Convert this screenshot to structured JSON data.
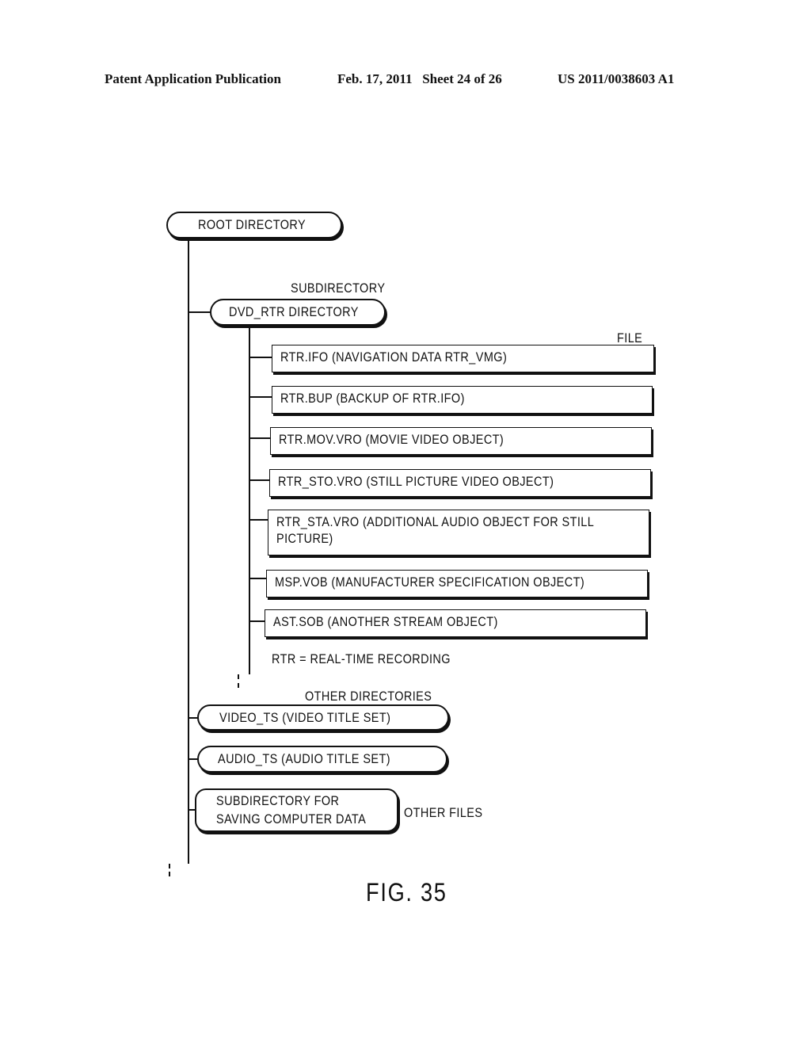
{
  "header": {
    "publication": "Patent Application Publication",
    "date_sheet": "Feb. 17, 2011   Sheet 24 of 26",
    "number": "US 2011/0038603 A1"
  },
  "diagram": {
    "root": "ROOT DIRECTORY",
    "subdirectory_label": "SUBDIRECTORY",
    "dvd_rtr": "DVD_RTR DIRECTORY",
    "file_label": "FILE",
    "files": [
      {
        "line1": "RTR.IFO (NAVIGATION DATA RTR_VMG)"
      },
      {
        "line1": "RTR.BUP (BACKUP OF RTR.IFO)"
      },
      {
        "line1": "RTR.MOV.VRO (MOVIE VIDEO OBJECT)"
      },
      {
        "line1": "RTR_STO.VRO (STILL PICTURE VIDEO OBJECT)"
      },
      {
        "line1": "RTR_STA.VRO (ADDITIONAL AUDIO OBJECT FOR STILL",
        "line2": "PICTURE)"
      },
      {
        "line1": "MSP.VOB (MANUFACTURER SPECIFICATION OBJECT)"
      },
      {
        "line1": "AST.SOB (ANOTHER STREAM OBJECT)"
      }
    ],
    "rtr_note": "RTR = REAL-TIME RECORDING",
    "other_directories_label": "OTHER DIRECTORIES",
    "video_ts": "VIDEO_TS (VIDEO TITLE SET)",
    "audio_ts": "AUDIO_TS (AUDIO TITLE SET)",
    "computer_dir_line1": "SUBDIRECTORY FOR",
    "computer_dir_line2": "SAVING COMPUTER DATA",
    "other_files_label": "OTHER FILES"
  },
  "figure_label": "FIG. 35"
}
